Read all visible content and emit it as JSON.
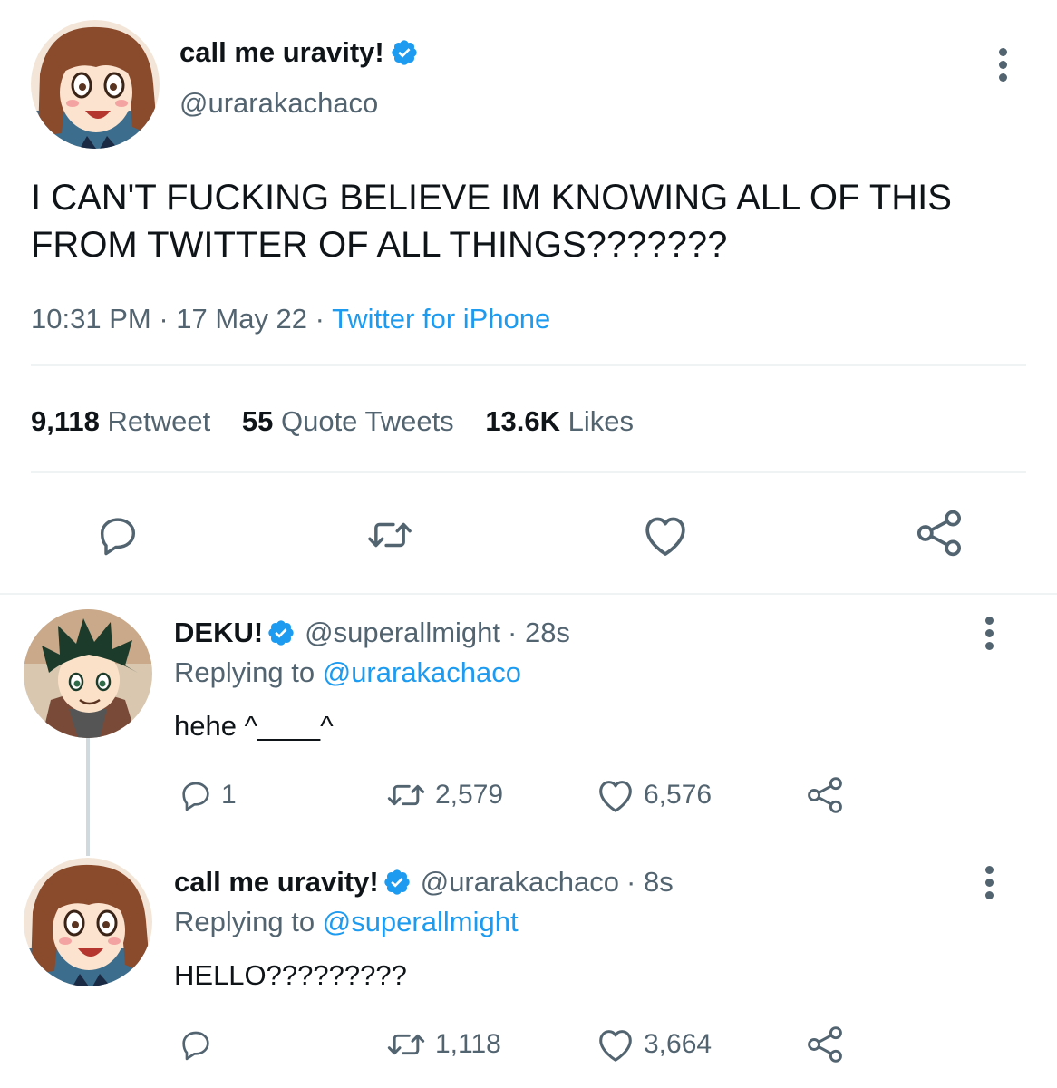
{
  "main_tweet": {
    "display_name": "call me uravity!",
    "handle": "@urarakachaco",
    "text_line1": "I CAN'T FUCKING BELIEVE IM KNOWING ALL OF THIS",
    "text_line2": "FROM TWITTER OF ALL THINGS???????",
    "time": "10:31 PM",
    "date": "17 May 22",
    "source": "Twitter for iPhone",
    "sep": "·",
    "stats": {
      "retweets_count": "9,118",
      "retweets_label": "Retweet",
      "quotes_count": "55",
      "quotes_label": "Quote Tweets",
      "likes_count": "13.6K",
      "likes_label": "Likes"
    }
  },
  "replies": [
    {
      "display_name": "DEKU!",
      "handle": "@superallmight",
      "age": "· 28s",
      "replying_prefix": "Replying to",
      "replying_to": "@urarakachaco",
      "text": "hehe ^____^",
      "reply_count": "1",
      "retweet_count": "2,579",
      "like_count": "6,576"
    },
    {
      "display_name": "call me uravity!",
      "handle": "@urarakachaco",
      "age": "· 8s",
      "replying_prefix": "Replying to",
      "replying_to": "@superallmight",
      "text": "HELLO?????????",
      "reply_count": "",
      "retweet_count": "1,118",
      "like_count": "3,664"
    }
  ],
  "icons": [
    "verified-badge-icon",
    "more-options-icon",
    "reply-icon",
    "retweet-icon",
    "like-icon",
    "share-icon"
  ],
  "colors": {
    "accent": "#1d9bf0",
    "text": "#0f1419",
    "muted": "#536471",
    "divider": "#eff3f4"
  }
}
